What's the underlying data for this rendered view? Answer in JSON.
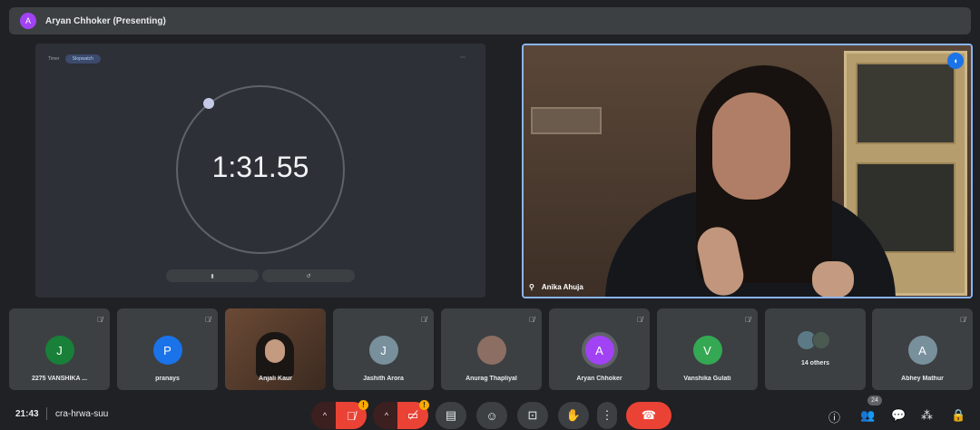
{
  "header": {
    "presenter_initial": "A",
    "title": "Aryan Chhoker (Presenting)"
  },
  "presentation": {
    "tab_left": "Timer",
    "tab_active": "Stopwatch",
    "timer": "1:31.55",
    "btn_left": "▮",
    "btn_right": "↺"
  },
  "main_video": {
    "name": "Anika Ahuja"
  },
  "participants": [
    {
      "initial": "J",
      "name": "2275 VANSHIKA ...",
      "color": "#188038"
    },
    {
      "initial": "P",
      "name": "pranays",
      "color": "#1a73e8"
    },
    {
      "initial": "",
      "name": "Anjali Kaur",
      "color": ""
    },
    {
      "initial": "J",
      "name": "Jashith Arora",
      "color": "#78909c"
    },
    {
      "initial": "",
      "name": "Anurag Thapliyal",
      "color": "#8d6e63"
    },
    {
      "initial": "A",
      "name": "Aryan Chhoker",
      "color": "#a142f4"
    },
    {
      "initial": "V",
      "name": "Vanshika Gulati",
      "color": "#34a853"
    },
    {
      "initial": "",
      "name": "14 others",
      "color": ""
    },
    {
      "initial": "A",
      "name": "Abhey Mathur",
      "color": "#78909c"
    }
  ],
  "bottom": {
    "time": "21:43",
    "meeting_code": "cra-hrwa-suu",
    "people_count": "24"
  }
}
